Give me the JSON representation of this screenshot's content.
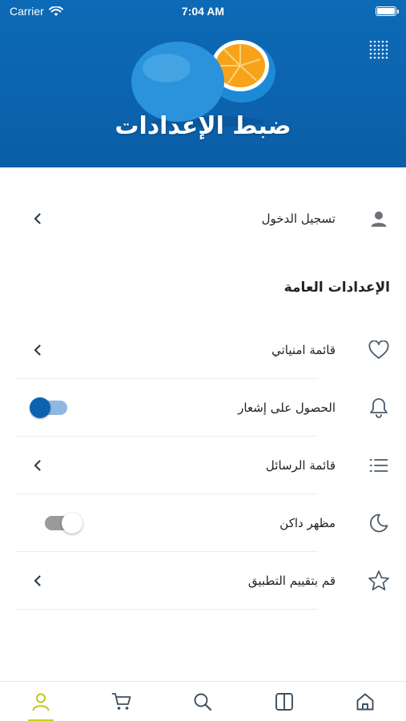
{
  "status_bar": {
    "carrier": "Carrier",
    "time": "7:04 AM",
    "battery_level": 1.0
  },
  "header": {
    "title": "ضبط الإعدادات",
    "banner_image": "orange-fruit-blue-background",
    "menu_icon": "grid-dots-icon"
  },
  "account": {
    "label": "تسجيل الدخول",
    "icon": "user-icon"
  },
  "general": {
    "section_title": "الإعدادات العامة",
    "items": [
      {
        "label": "قائمة امنياتي",
        "icon": "heart-icon",
        "control": "chevron"
      },
      {
        "label": "الحصول على إشعار",
        "icon": "bell-icon",
        "control": "toggle",
        "toggle_on": true
      },
      {
        "label": "قائمة الرسائل",
        "icon": "list-icon",
        "control": "chevron"
      },
      {
        "label": "مظهر داكن",
        "icon": "moon-icon",
        "control": "toggle",
        "toggle_on": false
      },
      {
        "label": "قم بتقييم التطبيق",
        "icon": "star-icon",
        "control": "chevron"
      }
    ]
  },
  "tab_bar": {
    "tabs": [
      {
        "name": "account",
        "icon": "user-icon",
        "active": true
      },
      {
        "name": "cart",
        "icon": "cart-icon",
        "active": false
      },
      {
        "name": "search",
        "icon": "search-icon",
        "active": false
      },
      {
        "name": "catalog",
        "icon": "book-icon",
        "active": false
      },
      {
        "name": "home",
        "icon": "home-icon",
        "active": false
      }
    ]
  },
  "colors": {
    "header_blue": "#0d6ab6",
    "accent_green": "#c8d400",
    "toggle_on": "#0d62b0",
    "icon_gray": "#4a5a6a"
  }
}
